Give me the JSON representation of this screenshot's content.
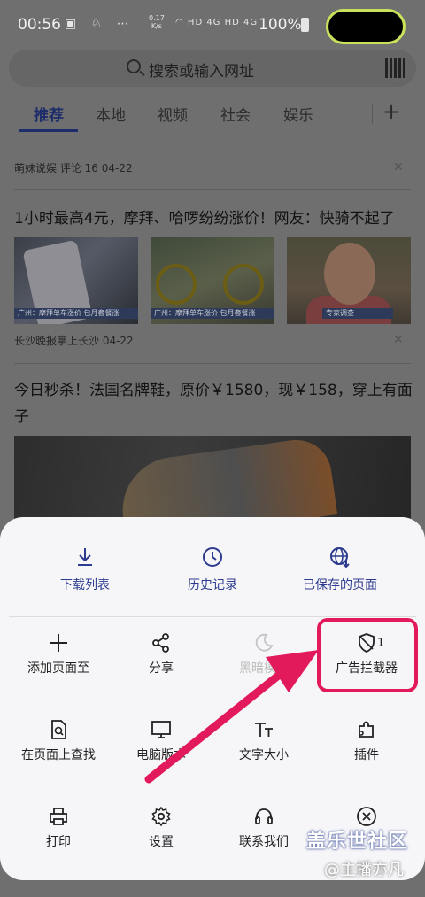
{
  "status_bar": {
    "time": "00:56",
    "net_speed_value": "0.17",
    "net_speed_unit": "K/s",
    "signal_labels": "HD 4G HD 4G",
    "battery": "100%"
  },
  "search": {
    "placeholder": "搜索或输入网址",
    "qr_icon": "qr-scan-icon"
  },
  "tabs": [
    "推荐",
    "本地",
    "视频",
    "社会",
    "娱乐"
  ],
  "tab_add_label": "+",
  "feed": [
    {
      "meta": "萌妹说娱  评论 16  04-22"
    },
    {
      "title": "1小时最高4元，摩拜、哈啰纷纷涨价！网友：快骑不起了",
      "meta": "长沙晚报掌上长沙  04-22",
      "captions": [
        "广州：摩拜单车涨价 包月套餐涨",
        "广州：摩拜单车涨价 包月套餐涨",
        "专家调查"
      ]
    },
    {
      "title": "今日秒杀！法国名牌鞋，原价￥1580，现￥158，穿上有面子"
    }
  ],
  "menu": {
    "top": [
      {
        "label": "下载列表",
        "icon": "download-icon"
      },
      {
        "label": "历史记录",
        "icon": "history-clock-icon"
      },
      {
        "label": "已保存的页面",
        "icon": "saved-pages-globe-icon"
      }
    ],
    "grid": [
      {
        "label": "添加页面至",
        "icon": "plus-icon"
      },
      {
        "label": "分享",
        "icon": "share-icon"
      },
      {
        "label": "黑暗模式",
        "icon": "moon-icon"
      },
      {
        "label": "广告拦截器",
        "icon": "shield-icon",
        "badge": "1"
      },
      {
        "label": "在页面上查找",
        "icon": "find-in-page-icon"
      },
      {
        "label": "电脑版本",
        "icon": "desktop-icon"
      },
      {
        "label": "文字大小",
        "icon": "text-size-icon"
      },
      {
        "label": "插件",
        "icon": "puzzle-icon"
      },
      {
        "label": "打印",
        "icon": "printer-icon"
      },
      {
        "label": "设置",
        "icon": "gear-icon"
      },
      {
        "label": "联系我们",
        "icon": "headset-icon"
      },
      {
        "label": "",
        "icon": "close-circle-icon"
      }
    ]
  },
  "watermark": {
    "line1": "盖乐世社区",
    "line2": "@主播亦凡"
  },
  "colors": {
    "accent": "#2d3b8e",
    "highlight": "#e21a5c"
  }
}
